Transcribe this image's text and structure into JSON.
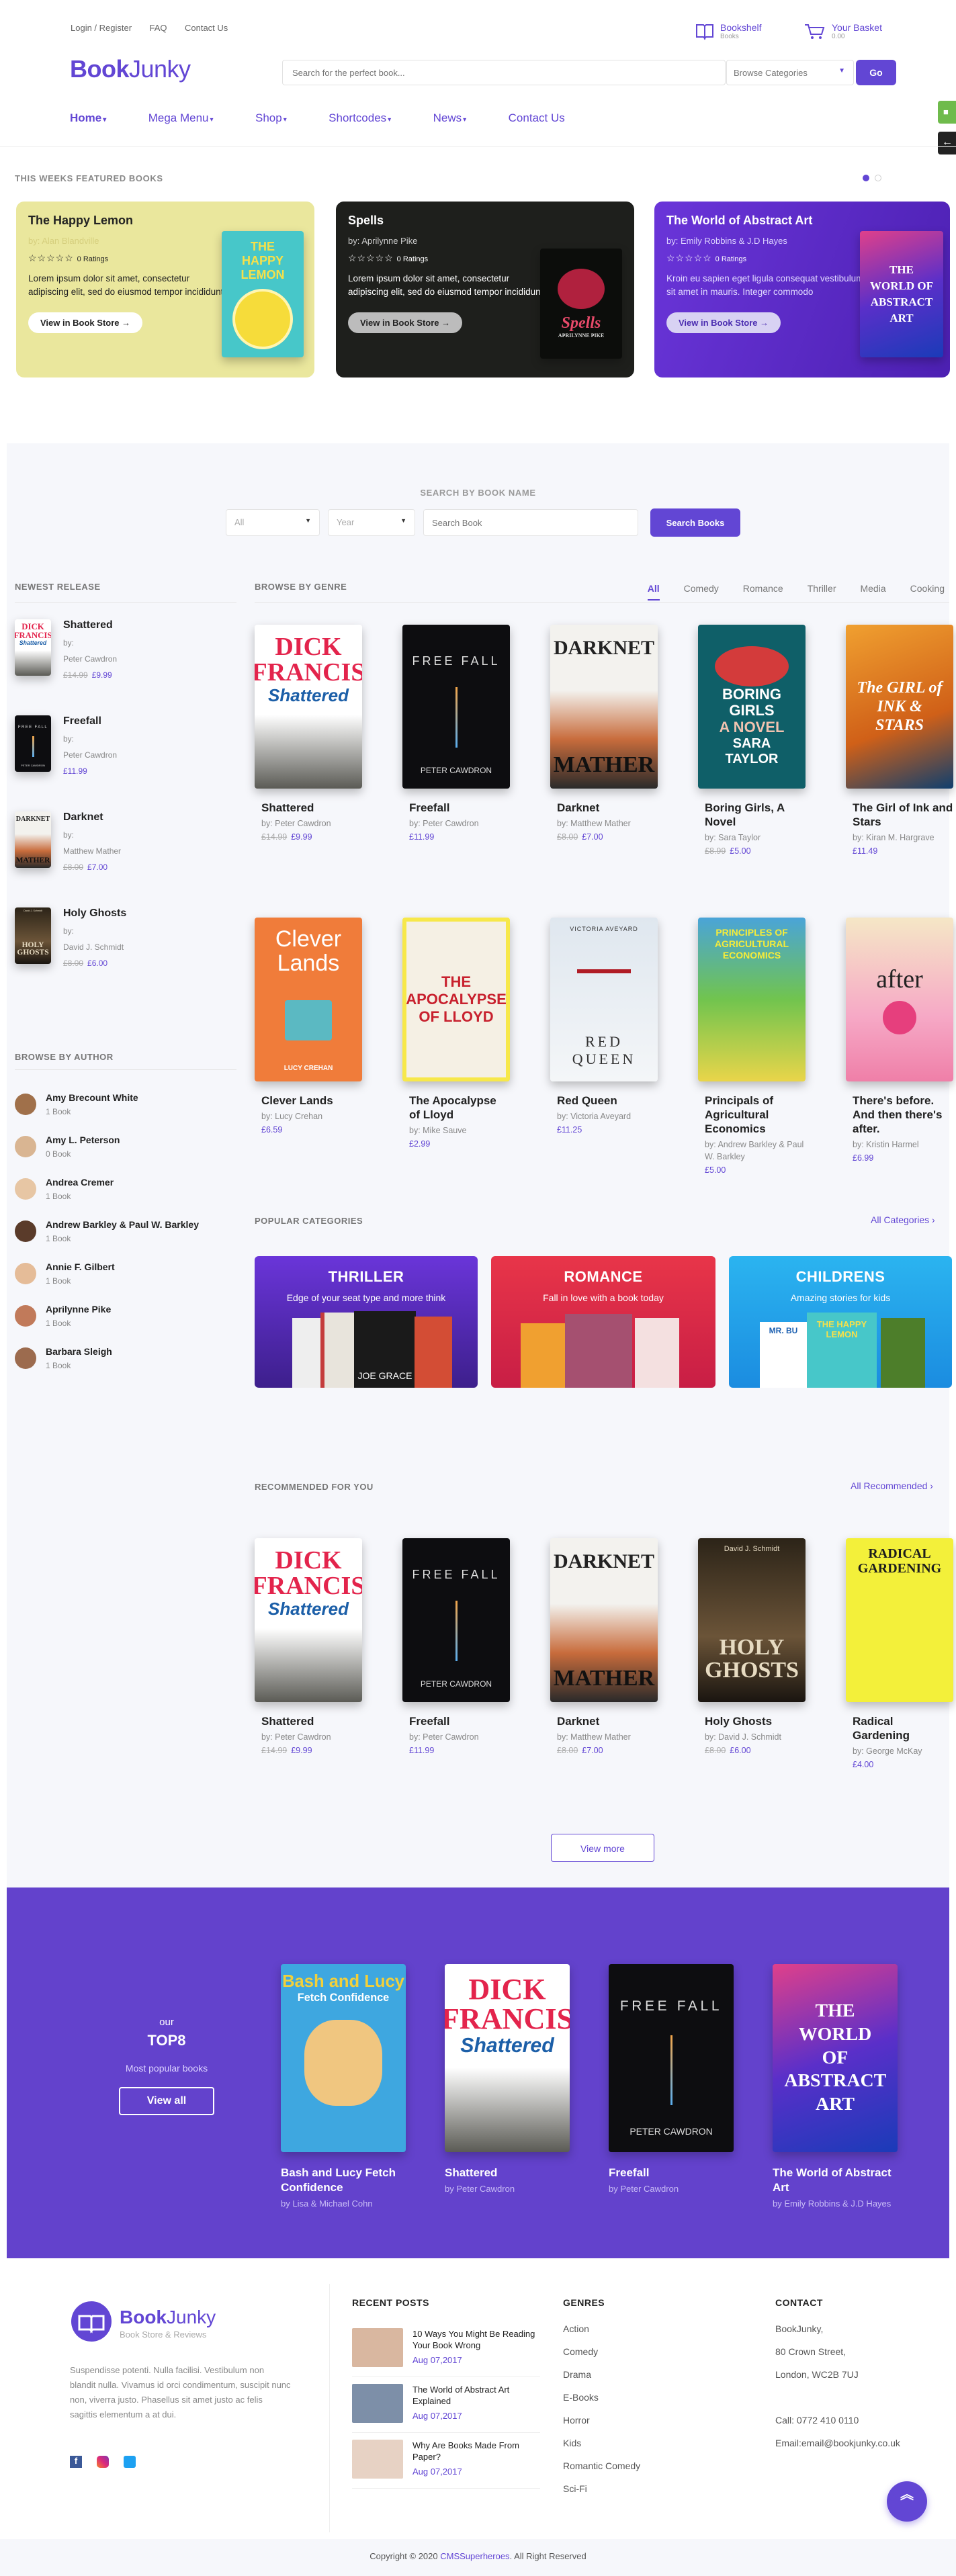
{
  "top_links": [
    "Login / Register",
    "FAQ",
    "Contact Us"
  ],
  "bookshelf": {
    "label": "Bookshelf",
    "sub": "Books"
  },
  "basket": {
    "label": "Your Basket",
    "sub": "0.00"
  },
  "logo": {
    "book": "Book",
    "junky": "Junky"
  },
  "search": {
    "placeholder": "Search for the perfect book...",
    "category": "Browse Categories",
    "go": "Go"
  },
  "nav": [
    "Home",
    "Mega Menu",
    "Shop",
    "Shortcodes",
    "News",
    "Contact Us"
  ],
  "featured": {
    "title": "THIS WEEKS FEATURED BOOKS",
    "cards": [
      {
        "title": "The Happy Lemon",
        "by": "by: Alan Blandville",
        "ratings": "0 Ratings",
        "text": "Lorem ipsum dolor sit amet, consectetur adipiscing elit, sed do eiusmod tempor incididunt",
        "button": "View in Book Store",
        "cover_title": "THE HAPPY LEMON"
      },
      {
        "title": "Spells",
        "by": "by: Aprilynne Pike",
        "ratings": "0 Ratings",
        "text": "Lorem ipsum dolor sit amet, consectetur adipiscing elit, sed do eiusmod tempor incididunt",
        "button": "View in Book Store",
        "cover_title": "Spells",
        "cover_author": "APRILYNNE PIKE"
      },
      {
        "title": "The World of Abstract Art",
        "by": "by: Emily Robbins & J.D Hayes",
        "ratings": "0 Ratings",
        "text": "Kroin eu sapien eget ligula consequat vestibulum sit amet in mauris. Integer commodo",
        "button": "View in Book Store",
        "cover_title": "THE WORLD OF ABSTRACT ART"
      }
    ]
  },
  "search_by_name": {
    "title": "SEARCH BY BOOK NAME",
    "all": "All",
    "year": "Year",
    "placeholder": "Search Book",
    "button": "Search Books"
  },
  "newest": {
    "title": "NEWEST RELEASE",
    "items": [
      {
        "title": "Shattered",
        "by": "by:",
        "author": "Peter Cawdron",
        "old": "£14.99",
        "price": "£9.99"
      },
      {
        "title": "Freefall",
        "by": "by:",
        "author": "Peter Cawdron",
        "old": "",
        "price": "£11.99"
      },
      {
        "title": "Darknet",
        "by": "by:",
        "author": "Matthew Mather",
        "old": "£8.00",
        "price": "£7.00"
      },
      {
        "title": "Holy Ghosts",
        "by": "by:",
        "author": "David J. Schmidt",
        "old": "£8.00",
        "price": "£6.00"
      }
    ]
  },
  "authors": {
    "title": "BROWSE BY AUTHOR",
    "items": [
      {
        "name": "Amy Brecount White",
        "count": "1 Book"
      },
      {
        "name": "Amy L. Peterson",
        "count": "0 Book"
      },
      {
        "name": "Andrea Cremer",
        "count": "1 Book"
      },
      {
        "name": "Andrew Barkley & Paul W. Barkley",
        "count": "1 Book"
      },
      {
        "name": "Annie F. Gilbert",
        "count": "1 Book"
      },
      {
        "name": "Aprilynne Pike",
        "count": "1 Book"
      },
      {
        "name": "Barbara Sleigh",
        "count": "1 Book"
      }
    ]
  },
  "genre": {
    "title": "BROWSE BY GENRE",
    "tabs": [
      "All",
      "Comedy",
      "Romance",
      "Thriller",
      "Media",
      "Cooking"
    ],
    "books": [
      {
        "title": "Shattered",
        "by": "by: Peter Cawdron",
        "old": "£14.99",
        "price": "£9.99"
      },
      {
        "title": "Freefall",
        "by": "by: Peter Cawdron",
        "old": "",
        "price": "£11.99"
      },
      {
        "title": "Darknet",
        "by": "by: Matthew Mather",
        "old": "£8.00",
        "price": "£7.00"
      },
      {
        "title": "Boring Girls, A Novel",
        "by": "by: Sara Taylor",
        "old": "£8.99",
        "price": "£5.00"
      },
      {
        "title": "The Girl of Ink and Stars",
        "by": "by: Kiran M. Hargrave",
        "old": "",
        "price": "£11.49"
      },
      {
        "title": "Clever Lands",
        "by": "by: Lucy Crehan",
        "old": "",
        "price": "£6.59"
      },
      {
        "title": "The Apocalypse of Lloyd",
        "by": "by: Mike Sauve",
        "old": "",
        "price": "£2.99"
      },
      {
        "title": "Red Queen",
        "by": "by: Victoria Aveyard",
        "old": "",
        "price": "£11.25"
      },
      {
        "title": "Principals of Agricultural Economics",
        "by": "by: Andrew Barkley & Paul W. Barkley",
        "old": "",
        "price": "£5.00"
      },
      {
        "title": "There's before. And then there's after.",
        "by": "by: Kristin Harmel",
        "old": "",
        "price": "£6.99"
      }
    ]
  },
  "popular": {
    "title": "POPULAR CATEGORIES",
    "link": "All Categories",
    "cats": [
      {
        "name": "THRILLER",
        "desc": "Edge of your seat type and more think"
      },
      {
        "name": "ROMANCE",
        "desc": "Fall in love with a book today"
      },
      {
        "name": "CHILDRENS",
        "desc": "Amazing stories for kids"
      }
    ]
  },
  "recommended": {
    "title": "RECOMMENDED FOR YOU",
    "link": "All Recommended",
    "books": [
      {
        "title": "Shattered",
        "by": "by: Peter Cawdron",
        "old": "£14.99",
        "price": "£9.99"
      },
      {
        "title": "Freefall",
        "by": "by: Peter Cawdron",
        "old": "",
        "price": "£11.99"
      },
      {
        "title": "Darknet",
        "by": "by: Matthew Mather",
        "old": "£8.00",
        "price": "£7.00"
      },
      {
        "title": "Holy Ghosts",
        "by": "by: David J. Schmidt",
        "old": "£8.00",
        "price": "£6.00"
      },
      {
        "title": "Radical Gardening",
        "by": "by: George McKay",
        "old": "",
        "price": "£4.00"
      }
    ],
    "more": "View more"
  },
  "top8": {
    "our": "our",
    "title": "TOP8",
    "sub": "Most popular books",
    "button": "View all",
    "books": [
      {
        "title": "Bash and Lucy Fetch Confidence",
        "by": "by Lisa & Michael Cohn"
      },
      {
        "title": "Shattered",
        "by": "by Peter Cawdron"
      },
      {
        "title": "Freefall",
        "by": "by Peter Cawdron"
      },
      {
        "title": "The World of Abstract Art",
        "by": "by Emily Robbins & J.D Hayes"
      }
    ]
  },
  "covers": {
    "dick": "DICK",
    "francis": "FRANCIS",
    "shattered": "Shattered",
    "freefall": "FREE FALL",
    "cawdron": "PETER CAWDRON",
    "darknet": "DARKNET",
    "mather": "MATHER",
    "boring": "BORING GIRLS",
    "anovel": "A NOVEL",
    "sara": "SARA TAYLOR",
    "girl": "The GIRL of INK & STARS",
    "clever": "Clever Lands",
    "crehan": "LUCY CREHAN",
    "apoc": "THE APOCALYPSE OF LLOYD",
    "redqueen": "RED QUEEN",
    "aveyard": "VICTORIA AVEYARD",
    "agri": "PRINCIPLES OF AGRICULTURAL ECONOMICS",
    "after": "after",
    "holy": "HOLY GHOSTS",
    "schmidt": "David J. Schmidt",
    "radical": "RADICAL GARDENING",
    "bash": "Bash and Lucy",
    "fetch": "Fetch Confidence",
    "thriller_cover": "JOE GRACE",
    "mr": "MR. BU"
  },
  "footer": {
    "logo_book": "Book",
    "logo_junky": "Junky",
    "tagline": "Book Store & Reviews",
    "about": "Suspendisse potenti. Nulla facilisi. Vestibulum non blandit nulla. Vivamus id orci condimentum, suscipit nunc non, viverra justo. Phasellus sit amet justo ac felis sagittis elementum a at dui.",
    "recent_title": "RECENT POSTS",
    "posts": [
      {
        "title": "10 Ways You Might Be Reading Your Book Wrong",
        "date": "Aug 07,2017"
      },
      {
        "title": "The World of Abstract Art Explained",
        "date": "Aug 07,2017"
      },
      {
        "title": "Why Are Books Made From Paper?",
        "date": "Aug 07,2017"
      }
    ],
    "genres_title": "GENRES",
    "genres": [
      "Action",
      "Comedy",
      "Drama",
      "E-Books",
      "Horror",
      "Kids",
      "Romantic Comedy",
      "Sci-Fi"
    ],
    "contact_title": "CONTACT",
    "contact": [
      "BookJunky,",
      "80 Crown Street,",
      "London, WC2B 7UJ"
    ],
    "phone": "Call: 0772 410 0110",
    "email": "Email:email@bookjunky.co.uk",
    "copy_pre": "Copyright © 2020 ",
    "copy_brand": "CMSSuperheroes",
    "copy_post": ". All Right Reserved"
  },
  "colors": {
    "accent": "#6246d4",
    "top8_bg": "#6342cc",
    "grey_bg": "#f6f7fb"
  }
}
